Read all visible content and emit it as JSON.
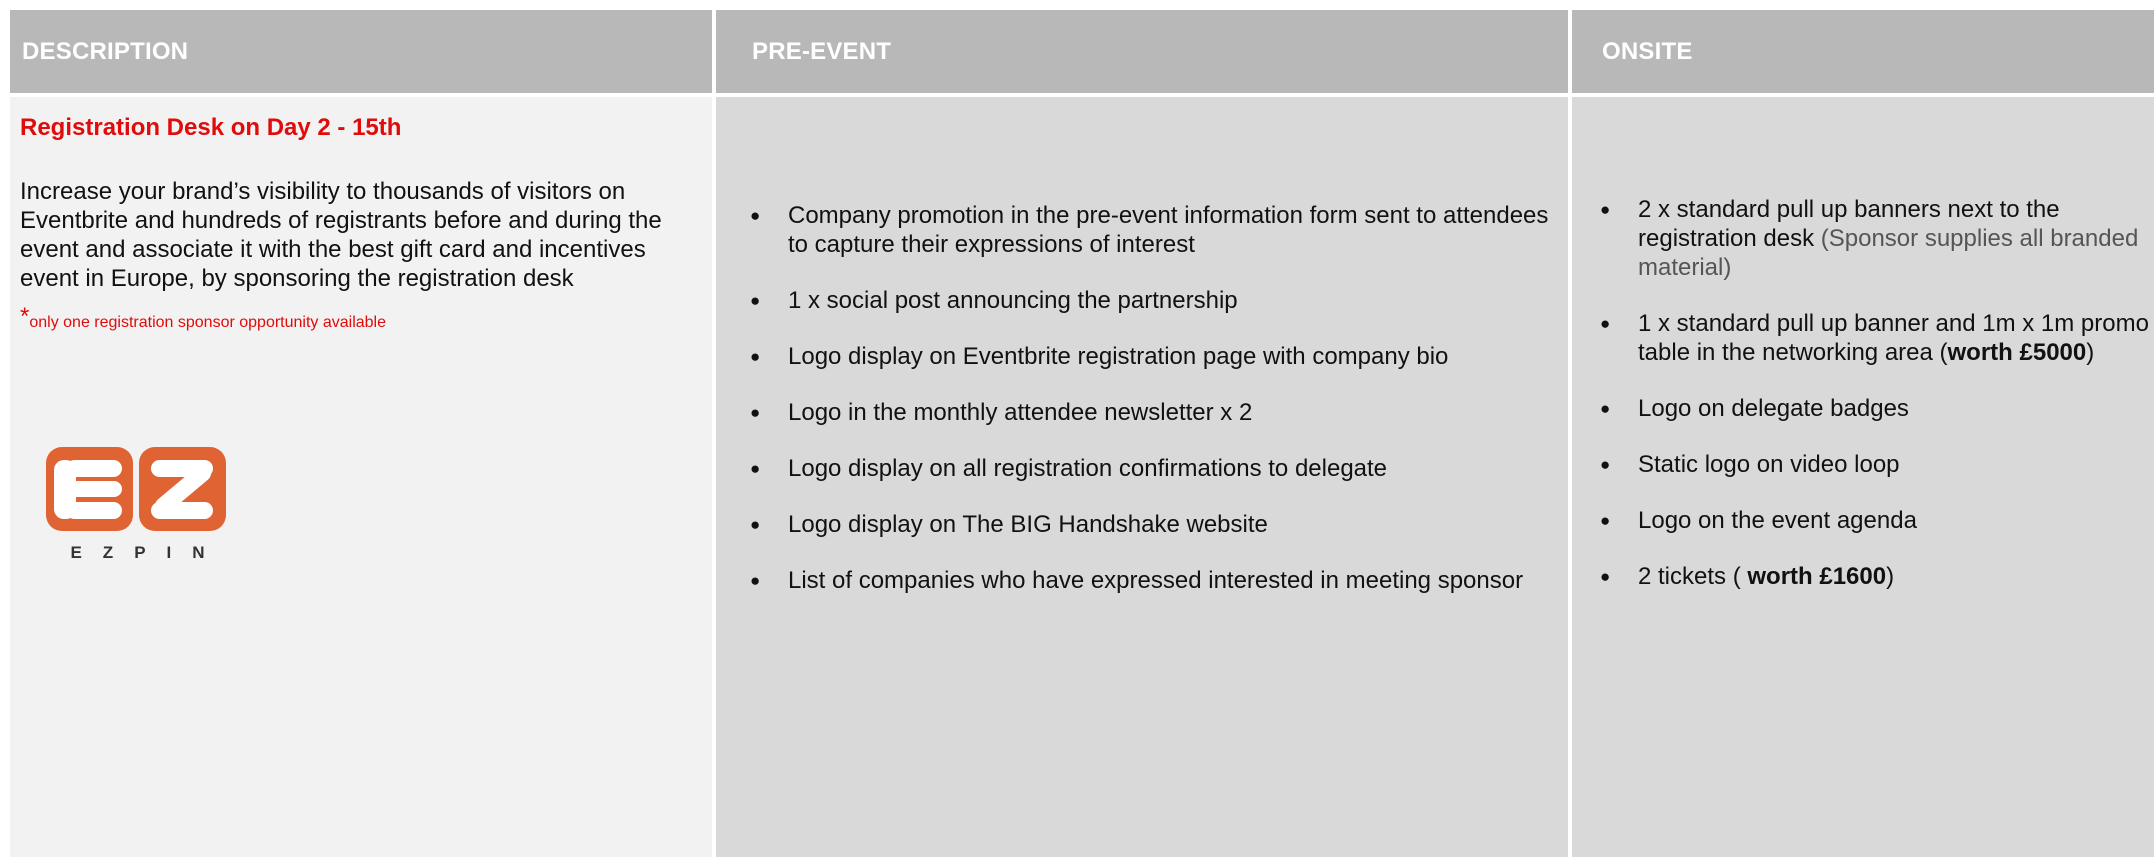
{
  "headers": {
    "description": "DESCRIPTION",
    "pre_event": "PRE-EVENT",
    "onsite": "ONSITE"
  },
  "description": {
    "title": "Registration Desk on Day 2 - 15th",
    "body": "Increase your brand’s visibility to thousands of visitors on Eventbrite and hundreds of registrants before and during the event and associate it with the best gift card and incentives event in Europe, by sponsoring the registration desk",
    "note_star": "*",
    "note": "only one registration sponsor opportunity available",
    "logo_text": "EZPIN"
  },
  "pre_event": [
    "Company promotion in the pre-event information form sent to attendees to capture their expressions of interest",
    "1 x social post announcing the partnership",
    "Logo display on Eventbrite registration page with company bio",
    "Logo in the monthly attendee newsletter x 2",
    "Logo display on all registration confirmations to delegate",
    "Logo display on The BIG Handshake website",
    "List of companies who have expressed interested in meeting sponsor"
  ],
  "onsite": {
    "item1_main": "2 x standard pull up banners next to the registration desk",
    "item1_note": " (Sponsor supplies all branded material)",
    "item2_pre": "1 x standard pull up banner and 1m x 1m promo table in the networking area (",
    "item2_bold": "worth £5000",
    "item2_post": ")",
    "item3": "Logo on delegate badges",
    "item4": "Static logo on video loop",
    "item5": "Logo on the event agenda",
    "item6_pre": "2 tickets ( ",
    "item6_bold": "worth £1600",
    "item6_post": ")"
  },
  "colors": {
    "header_bg": "#b8b8b8",
    "accent_red": "#e00b0b",
    "logo_orange": "#e06433"
  }
}
